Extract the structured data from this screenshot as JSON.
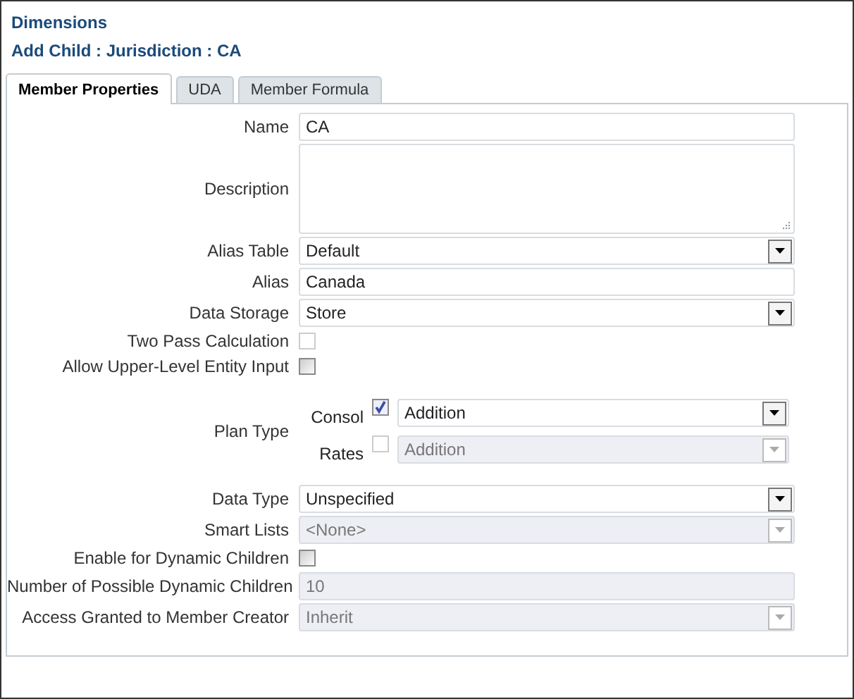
{
  "header": {
    "title": "Dimensions",
    "subtitle": "Add Child : Jurisdiction : CA"
  },
  "tabs": [
    {
      "label": "Member Properties",
      "selected": true
    },
    {
      "label": "UDA",
      "selected": false
    },
    {
      "label": "Member Formula",
      "selected": false
    }
  ],
  "fields": [
    {
      "kind": "text",
      "label": "Name",
      "value": "CA",
      "disabled": false
    },
    {
      "kind": "textarea",
      "label": "Description",
      "disabled": false
    },
    {
      "kind": "select",
      "label": "Alias Table",
      "value": "Default",
      "disabled": false
    },
    {
      "kind": "text",
      "label": "Alias",
      "value": "Canada",
      "disabled": false
    },
    {
      "kind": "select",
      "label": "Data Storage",
      "value": "Store",
      "disabled": false
    },
    {
      "kind": "checkbox",
      "label": "Two Pass Calculation",
      "checked": false,
      "disabled": true
    },
    {
      "kind": "checkbox",
      "label": "Allow Upper-Level Entity Input",
      "checked": false,
      "disabled": false
    },
    {
      "kind": "plantype",
      "label": "Plan Type",
      "plans": [
        {
          "name": "Consol",
          "checked": true,
          "value": "Addition",
          "disabled": false
        },
        {
          "name": "Rates",
          "checked": false,
          "value": "Addition",
          "disabled": true
        }
      ]
    },
    {
      "kind": "select",
      "label": "Data Type",
      "value": "Unspecified",
      "disabled": false
    },
    {
      "kind": "select",
      "label": "Smart Lists",
      "value": "<None>",
      "disabled": true
    },
    {
      "kind": "checkbox",
      "label": "Enable for Dynamic Children",
      "checked": false,
      "disabled": false
    },
    {
      "kind": "text",
      "label": "Number of Possible Dynamic Children",
      "value": "10",
      "disabled": true
    },
    {
      "kind": "select",
      "label": "Access Granted to Member Creator",
      "value": "Inherit",
      "disabled": true
    }
  ]
}
